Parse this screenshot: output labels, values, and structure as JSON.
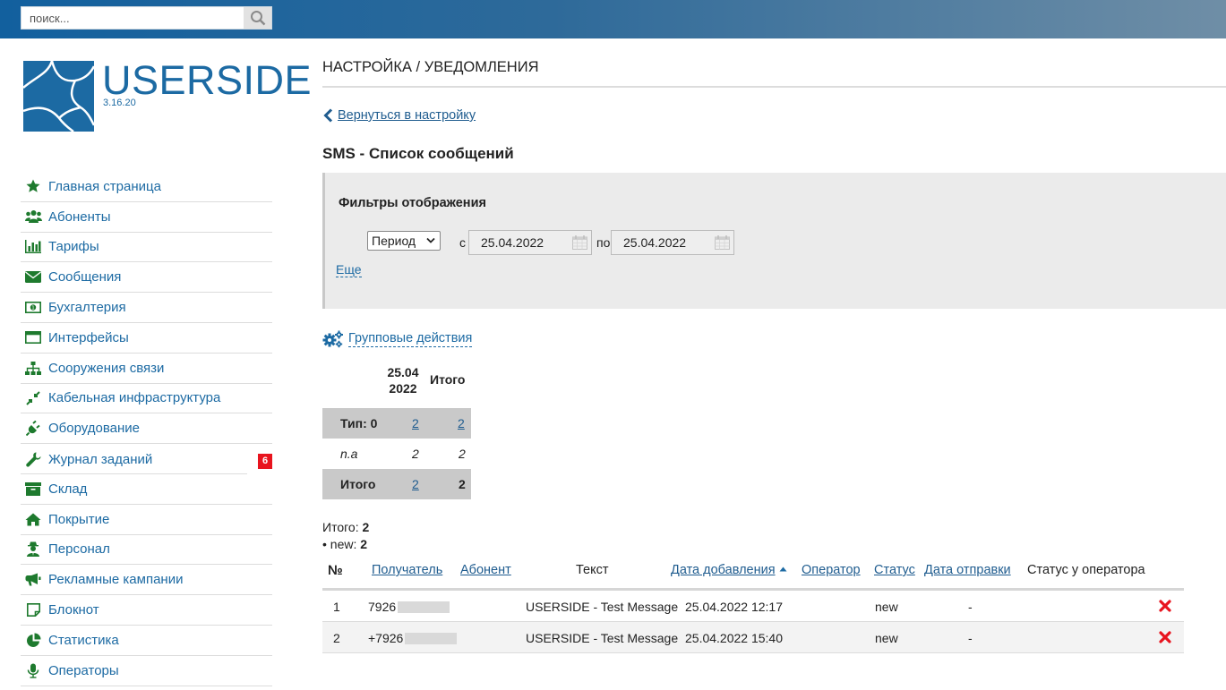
{
  "search": {
    "placeholder": "поиск..."
  },
  "brand": {
    "name": "USERSIDE",
    "version": "3.16.20"
  },
  "sidebar": {
    "items": [
      {
        "label": "Главная страница",
        "icon": "star-icon"
      },
      {
        "label": "Абоненты",
        "icon": "users-icon"
      },
      {
        "label": "Тарифы",
        "icon": "bar-chart-icon"
      },
      {
        "label": "Сообщения",
        "icon": "envelope-icon"
      },
      {
        "label": "Бухгалтерия",
        "icon": "money-icon"
      },
      {
        "label": "Интерфейсы",
        "icon": "window-icon"
      },
      {
        "label": "Сооружения связи",
        "icon": "sitemap-icon"
      },
      {
        "label": "Кабельная инфраструктура",
        "icon": "compress-icon"
      },
      {
        "label": "Оборудование",
        "icon": "plug-icon"
      },
      {
        "label": "Журнал заданий",
        "icon": "wrench-icon",
        "badge": "6"
      },
      {
        "label": "Склад",
        "icon": "archive-icon"
      },
      {
        "label": "Покрытие",
        "icon": "home-icon"
      },
      {
        "label": "Персонал",
        "icon": "user-secret-icon"
      },
      {
        "label": "Рекламные кампании",
        "icon": "bullhorn-icon"
      },
      {
        "label": "Блокнот",
        "icon": "sticky-note-icon"
      },
      {
        "label": "Статистика",
        "icon": "pie-chart-icon"
      },
      {
        "label": "Операторы",
        "icon": "microphone-icon"
      }
    ]
  },
  "main": {
    "page_title": "НАСТРОЙКА / УВЕДОМЛЕНИЯ",
    "back_link": "Вернуться в настройку",
    "section_title": "SMS - Список сообщений",
    "filters": {
      "title": "Фильтры отображения",
      "period_label": "Период",
      "from_label": "с",
      "from_date": "25.04.2022",
      "to_label": "по",
      "to_date": "25.04.2022",
      "more": "Еще"
    },
    "group_actions": "Групповые действия",
    "stats": {
      "col_date_line1": "25.04",
      "col_date_line2": "2022",
      "col_total": "Итого",
      "rows": [
        {
          "label": "Тип: 0",
          "v1": "2",
          "v2": "2"
        },
        {
          "label": "n.a",
          "v1": "2",
          "v2": "2"
        },
        {
          "label": "Итого",
          "v1": "2",
          "v2": "2"
        }
      ]
    },
    "totals": {
      "label": "Итого:",
      "value": "2",
      "new_label": "• new:",
      "new_value": "2"
    },
    "messages": {
      "columns": {
        "num": "№",
        "recipient": "Получатель",
        "subscriber": "Абонент",
        "text": "Текст",
        "date_added": "Дата добавления",
        "operator": "Оператор",
        "status": "Статус",
        "date_sent": "Дата отправки",
        "operator_status": "Статус у оператора"
      },
      "rows": [
        {
          "num": "1",
          "recipient": "7926",
          "text": "USERSIDE - Test Message",
          "date_added": "25.04.2022 12:17",
          "status": "new",
          "date_sent": "-"
        },
        {
          "num": "2",
          "recipient": "+7926",
          "text": "USERSIDE - Test Message",
          "date_added": "25.04.2022 15:40",
          "status": "new",
          "date_sent": "-"
        }
      ]
    }
  },
  "colors": {
    "accent": "#1c6aa3",
    "icon_green": "#1e7a2e",
    "badge": "#e8141e",
    "delete": "#e8141e"
  }
}
